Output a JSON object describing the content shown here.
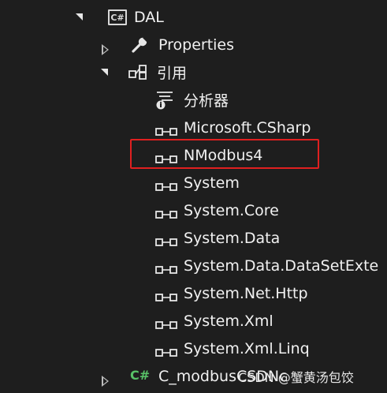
{
  "tree": {
    "dal": {
      "label": "DAL",
      "icon_text": "C#"
    },
    "properties": {
      "label": "Properties"
    },
    "references": {
      "label": "引用"
    },
    "analyzers": {
      "label": "分析器"
    },
    "ref_items": [
      "Microsoft.CSharp",
      "NModbus4",
      "System",
      "System.Core",
      "System.Data",
      "System.Data.DataSetExte",
      "System.Net.Http",
      "System.Xml",
      "System.Xml.Linq"
    ],
    "next_project": {
      "label": "C_modbusCSDNc",
      "icon_text": "C#"
    }
  },
  "highlighted_item": "NModbus4",
  "watermark": "CSDN @蟹黄汤包饺",
  "colors": {
    "background": "#1e1e1e",
    "text": "#f1f1f1",
    "highlight_box": "#e02020",
    "csharp_green": "#58c267"
  }
}
